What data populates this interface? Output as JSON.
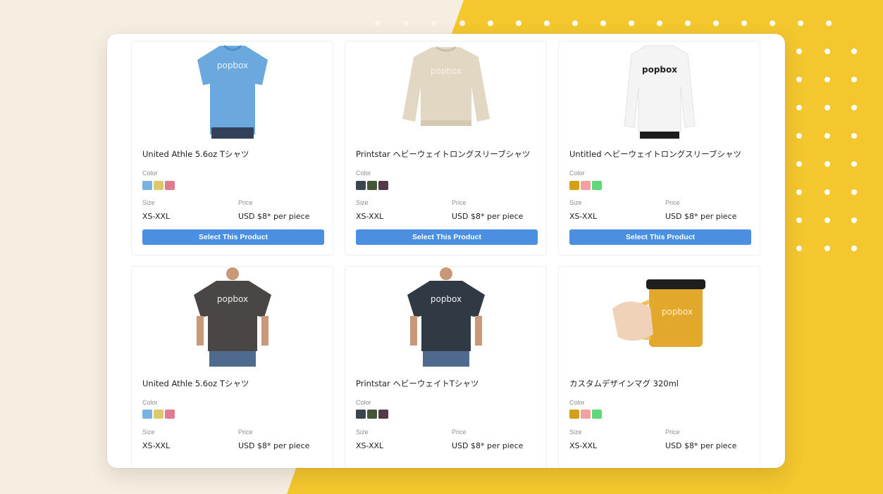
{
  "colors": {
    "background": "#f6efe1",
    "yellow": "#f4c72e",
    "button": "#4a8fe0"
  },
  "products": [
    {
      "title": "United Athle 5.6oz Tシャツ",
      "color_label": "Color",
      "swatches": [
        "#78b2e1",
        "#dcc96b",
        "#e07b91"
      ],
      "size_label": "Size",
      "size": "XS-XXL",
      "price_label": "Price",
      "price": "USD $8* per piece",
      "button": "Select This Product",
      "logo": "popbox",
      "image": "blue-tshirt"
    },
    {
      "title": "Printstar ヘビーウェイトロングスリーブシャツ",
      "color_label": "Color",
      "swatches": [
        "#3a4550",
        "#445638",
        "#55384a"
      ],
      "size_label": "Size",
      "size": "XS-XXL",
      "price_label": "Price",
      "price": "USD $8* per piece",
      "button": "Select This Product",
      "logo": "popbox",
      "image": "beige-sweatshirt"
    },
    {
      "title": "Untitled ヘビーウェイトロングスリーブシャツ",
      "color_label": "Color",
      "swatches": [
        "#d4a017",
        "#f2a0a0",
        "#5fd77a"
      ],
      "size_label": "Size",
      "size": "XS-XXL",
      "price_label": "Price",
      "price": "USD $8* per piece",
      "button": "Select This Product",
      "logo": "popbox",
      "image": "white-sweatshirt"
    },
    {
      "title": "United Athle 5.6oz Tシャツ",
      "color_label": "Color",
      "swatches": [
        "#78b2e1",
        "#dcc96b",
        "#e07b91"
      ],
      "size_label": "Size",
      "size": "XS-XXL",
      "price_label": "Price",
      "price": "USD $8* per piece",
      "logo": "popbox",
      "image": "charcoal-tshirt"
    },
    {
      "title": "Printstar ヘビーウェイトTシャツ",
      "color_label": "Color",
      "swatches": [
        "#3a4550",
        "#445638",
        "#55384a"
      ],
      "size_label": "Size",
      "size": "XS-XXL",
      "price_label": "Price",
      "price": "USD $8* per piece",
      "logo": "popbox",
      "image": "navy-tshirt"
    },
    {
      "title": "カスタムデザインマグ 320ml",
      "color_label": "Color",
      "swatches": [
        "#d4a017",
        "#f2a0a0",
        "#5fd77a"
      ],
      "size_label": "Size",
      "size": "XS-XXL",
      "price_label": "Price",
      "price": "USD $8* per piece",
      "logo": "popbox",
      "image": "glass-mug"
    }
  ]
}
